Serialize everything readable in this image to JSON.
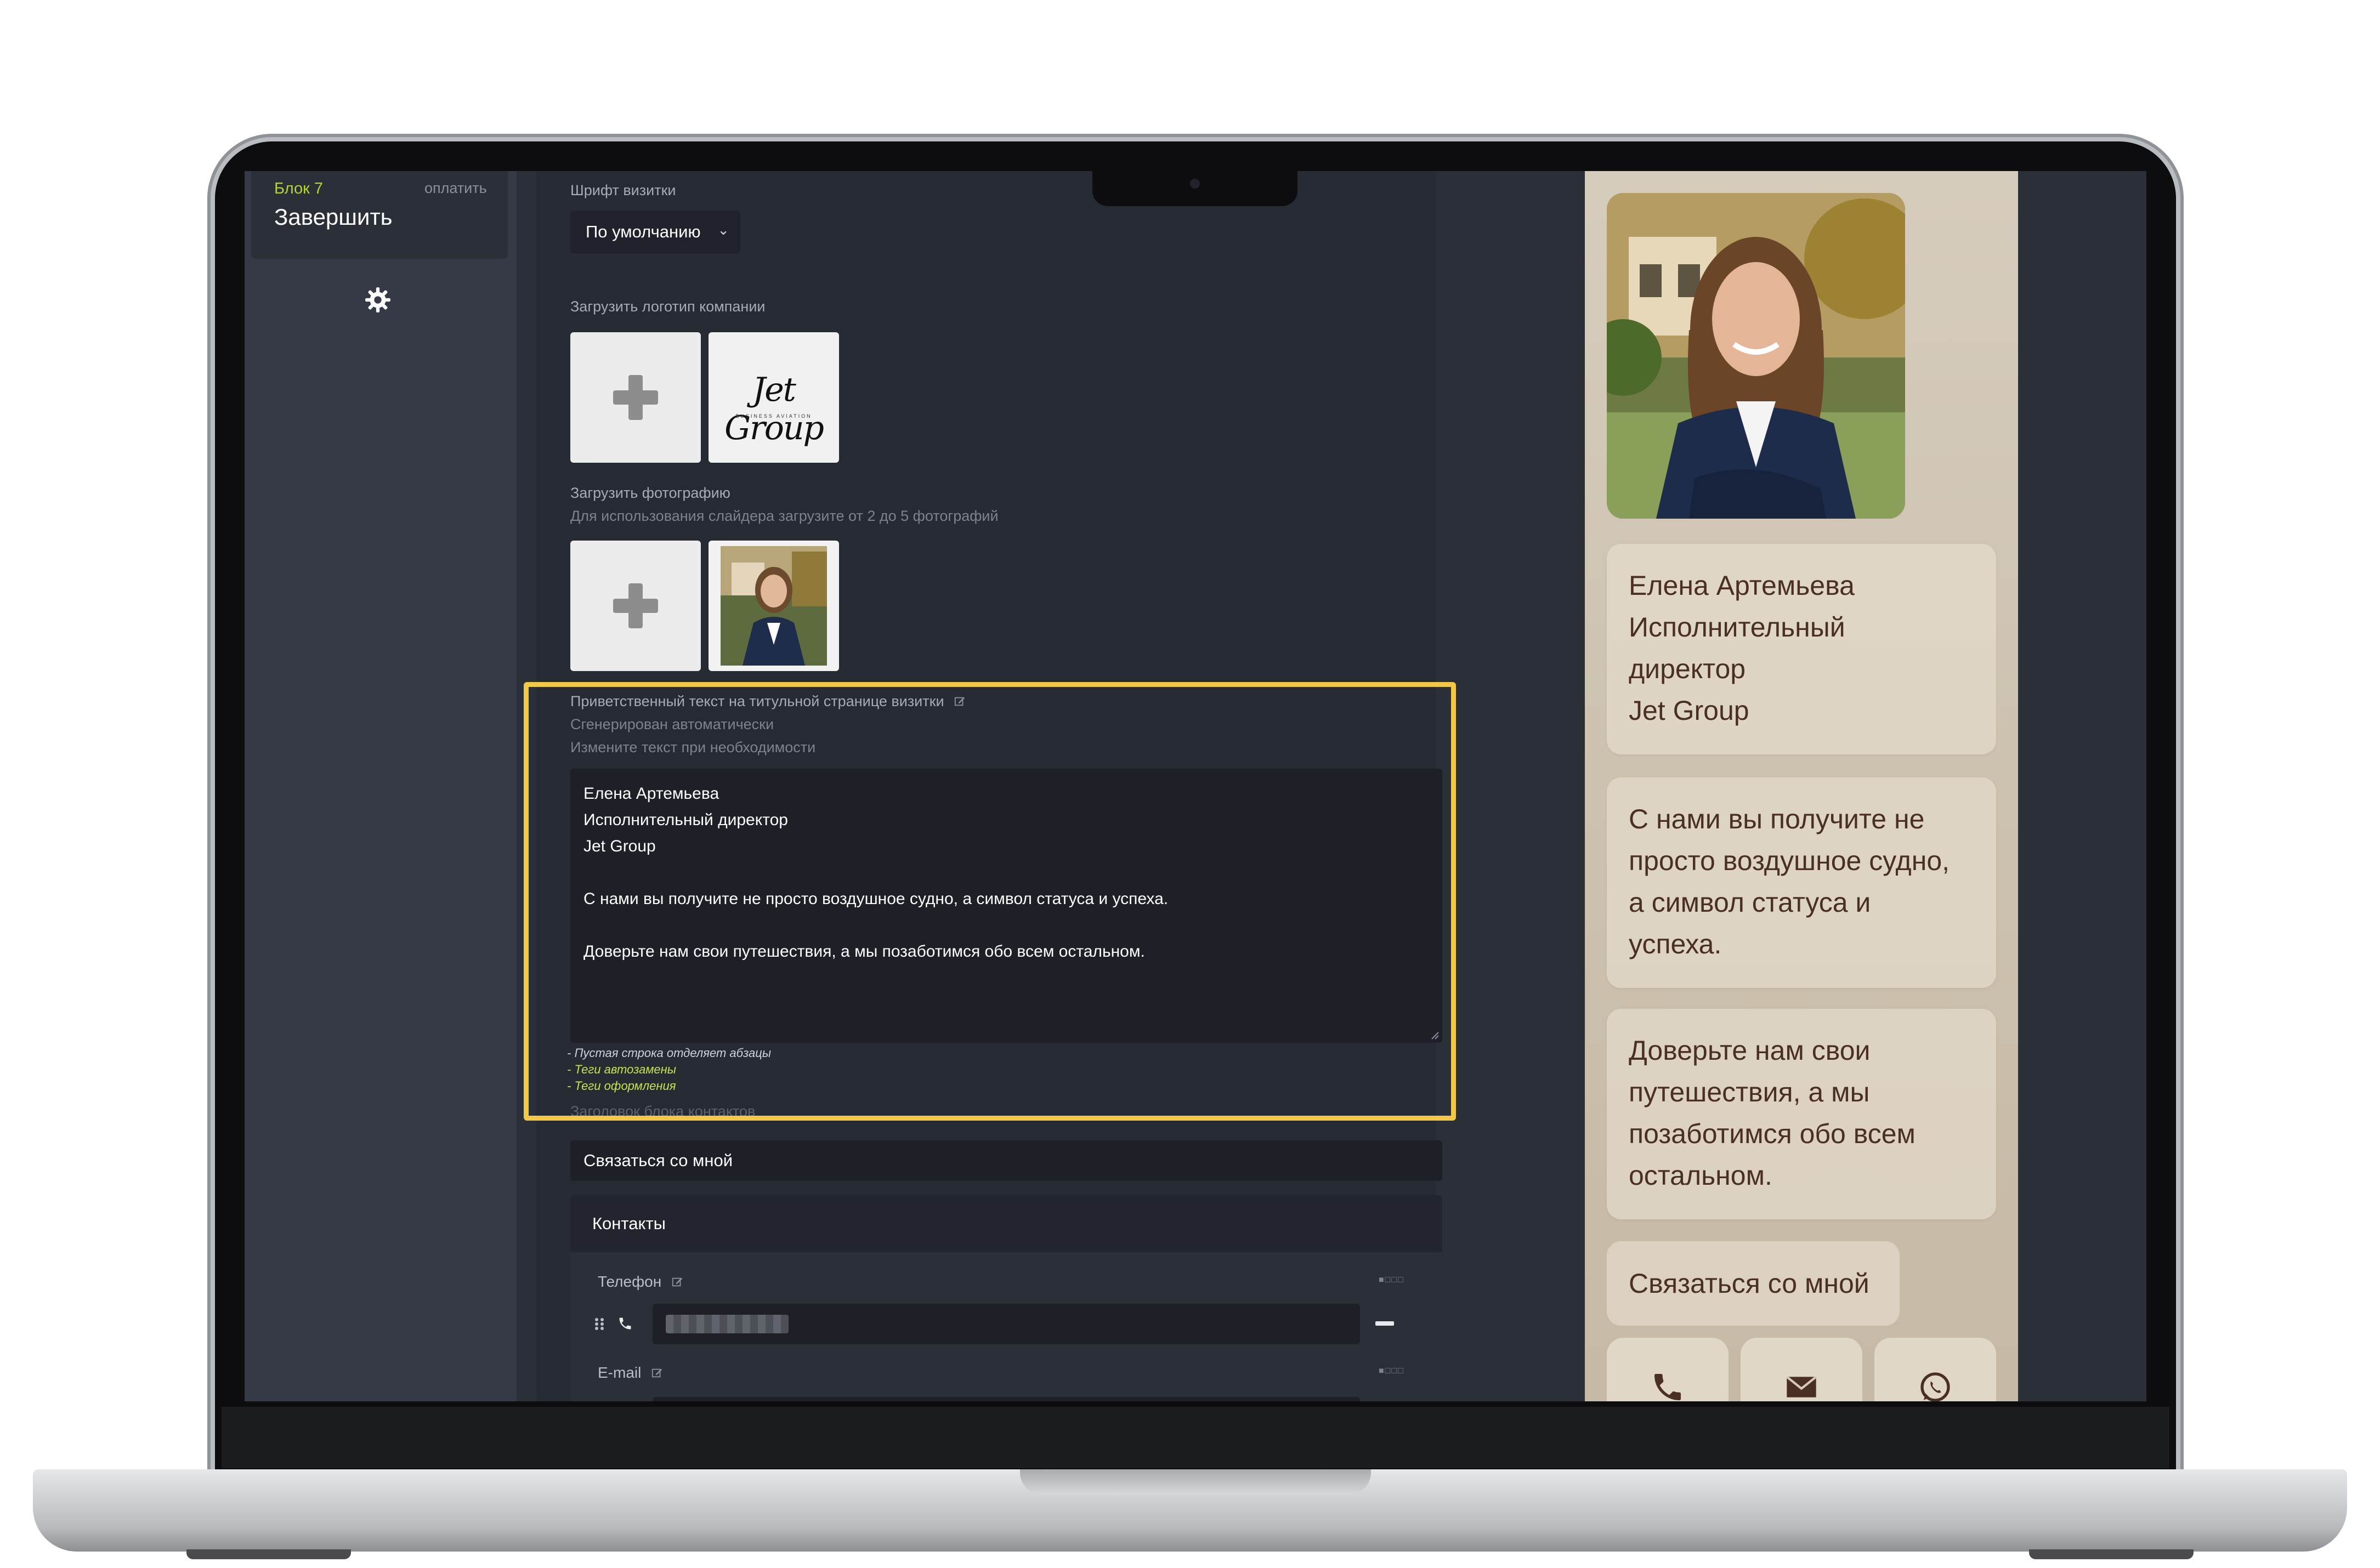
{
  "sidebar": {
    "block_label": "Блок 7",
    "pay_label": "оплатить",
    "finish_label": "Завершить",
    "settings_icon": "gear-icon"
  },
  "form": {
    "font_label": "Шрифт визитки",
    "font_value": "По умолчанию",
    "logo_label": "Загрузить логотип компании",
    "logo_text": "Jet Group",
    "logo_subtext": "BUSINESS AVIATION",
    "photo_label": "Загрузить фотографию",
    "photo_hint": "Для использования слайдера загрузите от 2 до 5 фотографий",
    "greeting": {
      "label": "Приветственный текст на титульной странице визитки",
      "generated_note": "Сгенерирован автоматически",
      "edit_note": "Измените текст при необходимости",
      "lines": [
        "Елена Артемьева",
        "Исполнительный директор",
        "Jet Group",
        "",
        "С нами вы получите не просто воздушное судно,  а символ статуса и успеха.",
        "",
        "Доверьте нам свои путешествия,  а мы позаботимся обо всем остальном."
      ],
      "hints": [
        "- Пустая строка отделяет абзацы",
        "- Теги автозамены",
        "- Теги оформления"
      ]
    },
    "contacts_title_label": "Заголовок блока контактов",
    "contacts_title_value": "Связаться со мной",
    "contacts": {
      "header": "Контакты",
      "phone_label": "Телефон",
      "email_label": "E-mail"
    }
  },
  "preview": {
    "name_card": [
      "Елена Артемьева",
      "Исполнительный",
      "директор",
      "Jet Group"
    ],
    "paragraph1": [
      "С нами вы получите не",
      "просто воздушное судно,",
      "а символ статуса и",
      "успеха."
    ],
    "paragraph2": [
      "Доверьте нам свои",
      "путешествия, а мы",
      "позаботимся обо всем",
      "остальном."
    ],
    "contact_button": "Связаться со мной",
    "contact_icons": [
      "phone-icon",
      "envelope-icon",
      "whatsapp-icon"
    ]
  },
  "colors": {
    "highlight": "#f3c846",
    "accent_green": "#b5d334",
    "preview_text": "#4a2f24"
  }
}
